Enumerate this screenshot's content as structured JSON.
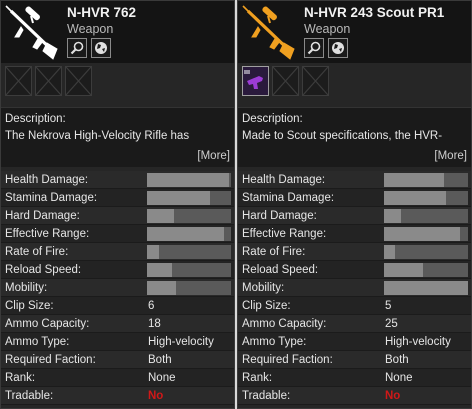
{
  "weapons": [
    {
      "name": "N-HVR 762",
      "type": "Weapon",
      "icon": "sniper-rifle-icon",
      "icon_color": "#ffffff",
      "slots": [
        "empty",
        "empty",
        "empty"
      ],
      "description_label": "Description:",
      "description_text": "The Nekrova High-Velocity Rifle has",
      "more_label": "[More]",
      "bar_stats": [
        {
          "label": "Health Damage:",
          "value": 0.98
        },
        {
          "label": "Stamina Damage:",
          "value": 0.75
        },
        {
          "label": "Hard Damage:",
          "value": 0.32
        },
        {
          "label": "Effective Range:",
          "value": 0.92
        },
        {
          "label": "Rate of Fire:",
          "value": 0.14
        },
        {
          "label": "Reload Speed:",
          "value": 0.3
        },
        {
          "label": "Mobility:",
          "value": 0.34
        }
      ],
      "text_stats": [
        {
          "label": "Clip Size:",
          "value": "6"
        },
        {
          "label": "Ammo Capacity:",
          "value": "18"
        },
        {
          "label": "Ammo Type:",
          "value": "High-velocity"
        },
        {
          "label": "Required Faction:",
          "value": "Both"
        },
        {
          "label": "Rank:",
          "value": "None"
        },
        {
          "label": "Tradable:",
          "value": "No"
        }
      ]
    },
    {
      "name": "N-HVR 243 Scout PR1",
      "type": "Weapon",
      "icon": "sniper-rifle-icon",
      "icon_color": "#f0a020",
      "slots": [
        "mod",
        "empty",
        "empty"
      ],
      "description_label": "Description:",
      "description_text": "Made to Scout specifications, the HVR-",
      "more_label": "[More]",
      "bar_stats": [
        {
          "label": "Health Damage:",
          "value": 0.72
        },
        {
          "label": "Stamina Damage:",
          "value": 0.74
        },
        {
          "label": "Hard Damage:",
          "value": 0.2
        },
        {
          "label": "Effective Range:",
          "value": 0.9
        },
        {
          "label": "Rate of Fire:",
          "value": 0.13
        },
        {
          "label": "Reload Speed:",
          "value": 0.47
        },
        {
          "label": "Mobility:",
          "value": 1.0
        }
      ],
      "text_stats": [
        {
          "label": "Clip Size:",
          "value": "5"
        },
        {
          "label": "Ammo Capacity:",
          "value": "25"
        },
        {
          "label": "Ammo Type:",
          "value": "High-velocity"
        },
        {
          "label": "Required Faction:",
          "value": "Both"
        },
        {
          "label": "Rank:",
          "value": "None"
        },
        {
          "label": "Tradable:",
          "value": "No"
        }
      ]
    }
  ],
  "colors": {
    "panel": "#262626",
    "bar_track": "#5a5a5a",
    "bar_fill": "#8a8a8a",
    "no_value": "#d01818",
    "mod_slot": "#9c3cd6"
  },
  "buttons": {
    "inspect_icon": "magnifier-icon",
    "market_icon": "globe-icon"
  }
}
